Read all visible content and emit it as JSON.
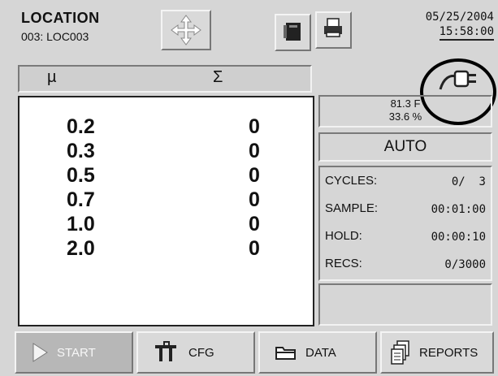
{
  "location": {
    "title": "LOCATION",
    "id": "003: LOC003"
  },
  "datetime": {
    "date": "05/25/2004",
    "time": "15:58:00"
  },
  "columns": {
    "size": "µ",
    "count": "Σ"
  },
  "particles": [
    {
      "size": "0.2",
      "count": "0"
    },
    {
      "size": "0.3",
      "count": "0"
    },
    {
      "size": "0.5",
      "count": "0"
    },
    {
      "size": "0.7",
      "count": "0"
    },
    {
      "size": "1.0",
      "count": "0"
    },
    {
      "size": "2.0",
      "count": "0"
    }
  ],
  "environment": {
    "temperature": "81.3 F",
    "humidity": "33.6 %"
  },
  "mode": "AUTO",
  "stats": [
    {
      "label": "CYCLES:",
      "value": "0/  3"
    },
    {
      "label": "SAMPLE:",
      "value": "00:01:00"
    },
    {
      "label": "HOLD:",
      "value": "00:00:10"
    },
    {
      "label": "RECS:",
      "value": "0/3000"
    }
  ],
  "buttons": {
    "start": "START",
    "cfg": "CFG",
    "data": "DATA",
    "reports": "REPORTS"
  },
  "icons": {
    "move": "move-arrows-icon",
    "notebook": "notebook-icon",
    "print": "printer-icon",
    "power": "power-plug-icon"
  }
}
